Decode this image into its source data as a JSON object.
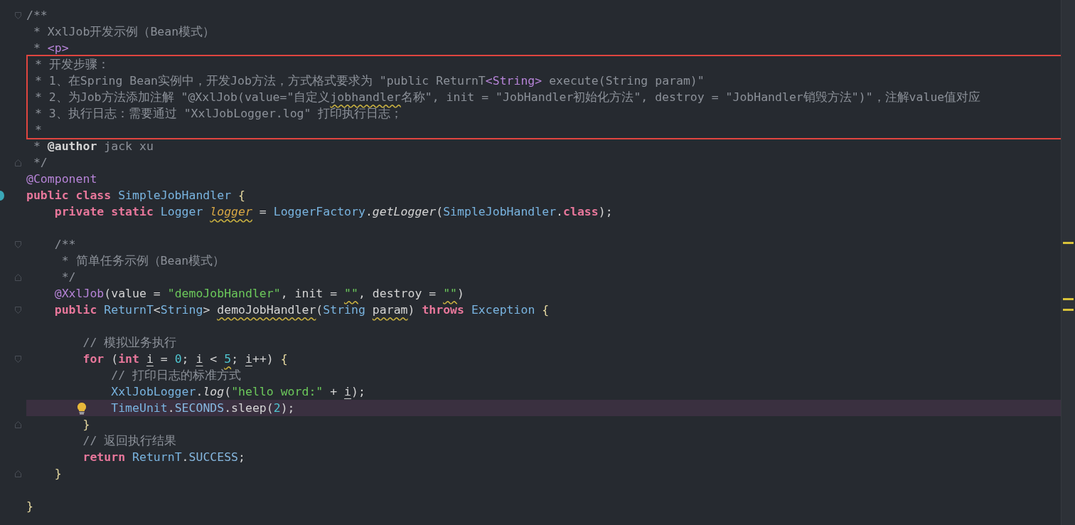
{
  "editor": {
    "lines": [
      {
        "fold_start": true,
        "tokens": [
          {
            "kind": "comment",
            "text": "/**"
          }
        ]
      },
      {
        "tokens": [
          {
            "kind": "comment",
            "text": " * XxlJob开发示例（Bean模式）"
          }
        ]
      },
      {
        "tokens": [
          {
            "kind": "comment",
            "text": " * "
          },
          {
            "kind": "tag",
            "text": "<p>"
          }
        ]
      },
      {
        "boxed": true,
        "tokens": [
          {
            "kind": "comment",
            "text": " * 开发步骤："
          }
        ]
      },
      {
        "boxed": true,
        "tokens": [
          {
            "kind": "comment",
            "text": " * 1、在Spring Bean实例中，开发Job方法，方式格式要求为 \"public ReturnT"
          },
          {
            "kind": "tag",
            "text": "<String>"
          },
          {
            "kind": "comment",
            "text": " execute(String param)\""
          }
        ]
      },
      {
        "boxed": true,
        "tokens": [
          {
            "kind": "comment",
            "text": " * 2、为Job方法添加注解 \"@XxlJob(value=\"自定义"
          },
          {
            "kind": "comment",
            "text": "jobhandler",
            "squiggle": true
          },
          {
            "kind": "comment",
            "text": "名称\", init = \"JobHandler初始化方法\", destroy = \"JobHandler销毁方法\")\"，注解value值对应"
          }
        ]
      },
      {
        "boxed": true,
        "tokens": [
          {
            "kind": "comment",
            "text": " * 3、执行日志：需要通过 \"XxlJobLogger.log\" 打印执行日志；"
          }
        ]
      },
      {
        "boxed": true,
        "tokens": [
          {
            "kind": "comment",
            "text": " *"
          }
        ]
      },
      {
        "tokens": [
          {
            "kind": "comment",
            "text": " * "
          },
          {
            "kind": "doctag",
            "text": "@author"
          },
          {
            "kind": "comment",
            "text": " jack xu"
          }
        ]
      },
      {
        "fold_end": true,
        "tokens": [
          {
            "kind": "comment",
            "text": " */"
          }
        ]
      },
      {
        "tokens": [
          {
            "kind": "annot",
            "text": "@Component"
          }
        ]
      },
      {
        "tokens": [
          {
            "kind": "kw",
            "text": "public class "
          },
          {
            "kind": "type",
            "text": "SimpleJobHandler"
          },
          {
            "kind": "brace",
            "text": " {"
          }
        ]
      },
      {
        "tokens": [
          {
            "kind": "kw",
            "text": "    private static "
          },
          {
            "kind": "type",
            "text": "Logger "
          },
          {
            "kind": "field",
            "text": "logger",
            "squiggle": true
          },
          {
            "kind": "plain",
            "text": " = "
          },
          {
            "kind": "type",
            "text": "LoggerFactory"
          },
          {
            "kind": "plain",
            "text": "."
          },
          {
            "kind": "method",
            "text": "getLogger"
          },
          {
            "kind": "plain",
            "text": "("
          },
          {
            "kind": "type",
            "text": "SimpleJobHandler"
          },
          {
            "kind": "plain",
            "text": "."
          },
          {
            "kind": "kw",
            "text": "class"
          },
          {
            "kind": "plain",
            "text": ");"
          }
        ]
      },
      {
        "gap_before": true,
        "fold_start": true,
        "tokens": [
          {
            "kind": "comment",
            "text": "    /**"
          }
        ]
      },
      {
        "tokens": [
          {
            "kind": "comment",
            "text": "     * 简单任务示例（Bean模式）"
          }
        ]
      },
      {
        "fold_end": true,
        "tokens": [
          {
            "kind": "comment",
            "text": "     */"
          }
        ]
      },
      {
        "tokens": [
          {
            "kind": "annot",
            "text": "    @XxlJob"
          },
          {
            "kind": "plain",
            "text": "(value = "
          },
          {
            "kind": "str",
            "text": "\"demoJobHandler\""
          },
          {
            "kind": "plain",
            "text": ", init = "
          },
          {
            "kind": "str",
            "text": "\"\"",
            "squiggle": true
          },
          {
            "kind": "plain",
            "text": ", destroy = "
          },
          {
            "kind": "str",
            "text": "\"\"",
            "squiggle": true
          },
          {
            "kind": "plain",
            "text": ")"
          }
        ]
      },
      {
        "fold_start": true,
        "tokens": [
          {
            "kind": "kw",
            "text": "    public "
          },
          {
            "kind": "type",
            "text": "ReturnT"
          },
          {
            "kind": "plain",
            "text": "<"
          },
          {
            "kind": "type",
            "text": "String"
          },
          {
            "kind": "plain",
            "text": "> "
          },
          {
            "kind": "plain",
            "text": "demoJobHandler",
            "squiggle": true
          },
          {
            "kind": "plain",
            "text": "("
          },
          {
            "kind": "type",
            "text": "String "
          },
          {
            "kind": "plain",
            "text": "param",
            "squiggle": true
          },
          {
            "kind": "plain",
            "text": ") "
          },
          {
            "kind": "kw",
            "text": "throws "
          },
          {
            "kind": "type",
            "text": "Exception"
          },
          {
            "kind": "brace",
            "text": " {"
          }
        ]
      },
      {
        "gap_before": true,
        "tokens": [
          {
            "kind": "comment",
            "text": "        // 模拟业务执行"
          }
        ]
      },
      {
        "fold_start": true,
        "tokens": [
          {
            "kind": "kw",
            "text": "        for "
          },
          {
            "kind": "plain",
            "text": "("
          },
          {
            "kind": "kw",
            "text": "int "
          },
          {
            "kind": "plain",
            "text": "i",
            "underlined": true
          },
          {
            "kind": "plain",
            "text": " = "
          },
          {
            "kind": "num",
            "text": "0"
          },
          {
            "kind": "plain",
            "text": "; "
          },
          {
            "kind": "plain",
            "text": "i",
            "underlined": true
          },
          {
            "kind": "plain",
            "text": " < "
          },
          {
            "kind": "num",
            "text": "5",
            "squiggle": true
          },
          {
            "kind": "plain",
            "text": "; "
          },
          {
            "kind": "plain",
            "text": "i",
            "underlined": true
          },
          {
            "kind": "plain",
            "text": "++) "
          },
          {
            "kind": "brace",
            "text": "{"
          }
        ]
      },
      {
        "tokens": [
          {
            "kind": "comment",
            "text": "            // 打印日志的标准方式"
          }
        ]
      },
      {
        "tokens": [
          {
            "kind": "type",
            "text": "            XxlJobLogger"
          },
          {
            "kind": "plain",
            "text": "."
          },
          {
            "kind": "method",
            "text": "log"
          },
          {
            "kind": "plain",
            "text": "("
          },
          {
            "kind": "str",
            "text": "\"hello word:\""
          },
          {
            "kind": "plain",
            "text": " + "
          },
          {
            "kind": "plain",
            "text": "i",
            "underlined": true
          },
          {
            "kind": "plain",
            "text": ");"
          }
        ]
      },
      {
        "current": true,
        "tokens": [
          {
            "kind": "type",
            "text": "            TimeUnit"
          },
          {
            "kind": "plain",
            "text": "."
          },
          {
            "kind": "const",
            "text": "SECONDS"
          },
          {
            "kind": "plain",
            "text": ".sleep("
          },
          {
            "kind": "num",
            "text": "2"
          },
          {
            "kind": "plain",
            "text": ");"
          }
        ]
      },
      {
        "fold_end": true,
        "tokens": [
          {
            "kind": "brace",
            "text": "        }"
          }
        ]
      },
      {
        "tokens": [
          {
            "kind": "comment",
            "text": "        // 返回执行结果"
          }
        ]
      },
      {
        "tokens": [
          {
            "kind": "kw",
            "text": "        return "
          },
          {
            "kind": "type",
            "text": "ReturnT"
          },
          {
            "kind": "plain",
            "text": "."
          },
          {
            "kind": "const",
            "text": "SUCCESS"
          },
          {
            "kind": "plain",
            "text": ";"
          }
        ]
      },
      {
        "fold_end": true,
        "tokens": [
          {
            "kind": "brace",
            "text": "    }"
          }
        ]
      },
      {
        "gap_before": true,
        "tokens": [
          {
            "kind": "brace",
            "text": "}"
          }
        ]
      }
    ]
  }
}
